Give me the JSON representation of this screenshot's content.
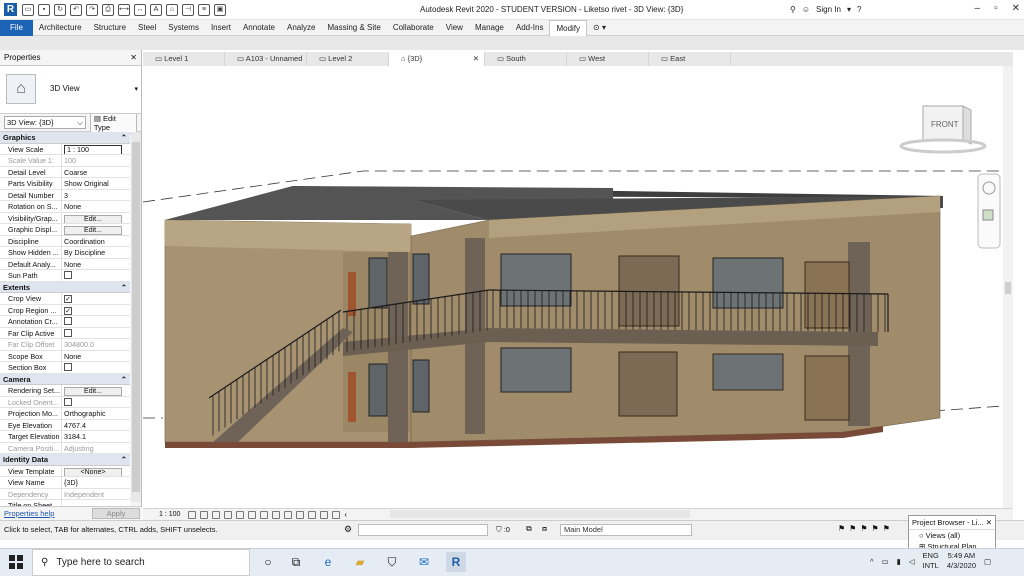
{
  "app": {
    "logo": "R",
    "title": "Autodesk Revit 2020 - STUDENT VERSION - Liketso rivet - 3D View: {3D}",
    "sign_in": "Sign In"
  },
  "ribbon": {
    "tabs": [
      "File",
      "Architecture",
      "Structure",
      "Steel",
      "Systems",
      "Insert",
      "Annotate",
      "Analyze",
      "Massing & Site",
      "Collaborate",
      "View",
      "Manage",
      "Add-Ins",
      "Modify"
    ],
    "active": "Modify"
  },
  "properties": {
    "title": "Properties",
    "type_name": "3D View",
    "selector": "3D View: {3D}",
    "edit_type": "Edit Type",
    "groups": [
      {
        "name": "Graphics",
        "rows": [
          {
            "k": "View Scale",
            "v": "1 : 100",
            "kind": "input"
          },
          {
            "k": "Scale Value    1:",
            "v": "100",
            "dis": true
          },
          {
            "k": "Detail Level",
            "v": "Coarse"
          },
          {
            "k": "Parts Visibility",
            "v": "Show Original"
          },
          {
            "k": "Detail Number",
            "v": "3"
          },
          {
            "k": "Rotation on S...",
            "v": "None"
          },
          {
            "k": "Visibility/Grap...",
            "v": "Edit...",
            "kind": "btn"
          },
          {
            "k": "Graphic Displ...",
            "v": "Edit...",
            "kind": "btn"
          },
          {
            "k": "Discipline",
            "v": "Coordination"
          },
          {
            "k": "Show Hidden ...",
            "v": "By Discipline"
          },
          {
            "k": "Default Analy...",
            "v": "None"
          },
          {
            "k": "Sun Path",
            "v": "",
            "kind": "cb",
            "checked": false
          }
        ]
      },
      {
        "name": "Extents",
        "rows": [
          {
            "k": "Crop View",
            "v": "",
            "kind": "cb",
            "checked": true
          },
          {
            "k": "Crop Region ...",
            "v": "",
            "kind": "cb",
            "checked": true
          },
          {
            "k": "Annotation Cr...",
            "v": "",
            "kind": "cb",
            "checked": false
          },
          {
            "k": "Far Clip Active",
            "v": "",
            "kind": "cb",
            "checked": false
          },
          {
            "k": "Far Clip Offset",
            "v": "304800.0",
            "dis": true
          },
          {
            "k": "Scope Box",
            "v": "None"
          },
          {
            "k": "Section Box",
            "v": "",
            "kind": "cb",
            "checked": false
          }
        ]
      },
      {
        "name": "Camera",
        "rows": [
          {
            "k": "Rendering Set...",
            "v": "Edit...",
            "kind": "btn"
          },
          {
            "k": "Locked Orient...",
            "v": "",
            "kind": "cb",
            "checked": false,
            "dis": true
          },
          {
            "k": "Projection Mo...",
            "v": "Orthographic"
          },
          {
            "k": "Eye Elevation",
            "v": "4767.4"
          },
          {
            "k": "Target Elevation",
            "v": "3184.1"
          },
          {
            "k": "Camera Positi...",
            "v": "Adjusting",
            "dis": true
          }
        ]
      },
      {
        "name": "Identity Data",
        "rows": [
          {
            "k": "View Template",
            "v": "<None>",
            "kind": "btn"
          },
          {
            "k": "View Name",
            "v": "{3D}"
          },
          {
            "k": "Dependency",
            "v": "Independent",
            "dis": true
          },
          {
            "k": "Title on Sheet",
            "v": ""
          }
        ]
      }
    ],
    "help": "Properties help",
    "apply": "Apply"
  },
  "view_tabs": [
    {
      "label": "Level 1"
    },
    {
      "label": "A103 - Unnamed"
    },
    {
      "label": "Level 2"
    },
    {
      "label": "{3D}",
      "active": true
    },
    {
      "label": "South"
    },
    {
      "label": "West"
    },
    {
      "label": "East"
    }
  ],
  "viewcube": {
    "face": "FRONT"
  },
  "view_control": {
    "scale": "1 : 100"
  },
  "status": {
    "text": "Click to select, TAB for alternates, CTRL adds, SHIFT unselects.",
    "zero": ":0",
    "model": "Main Model"
  },
  "project_browser": {
    "title": "Project Browser - Li...",
    "items": [
      "Views (all)",
      "Structural Plan"
    ]
  },
  "taskbar": {
    "search": "Type here to search",
    "lang1": "ENG",
    "lang2": "INTL",
    "time": "5:49 AM",
    "date": "4/3/2020"
  },
  "colors": {
    "ribbon_file": "#1b63b5",
    "wall": "#a08c6a",
    "stone": "#6e6356",
    "roof": "#4a4a4a"
  }
}
